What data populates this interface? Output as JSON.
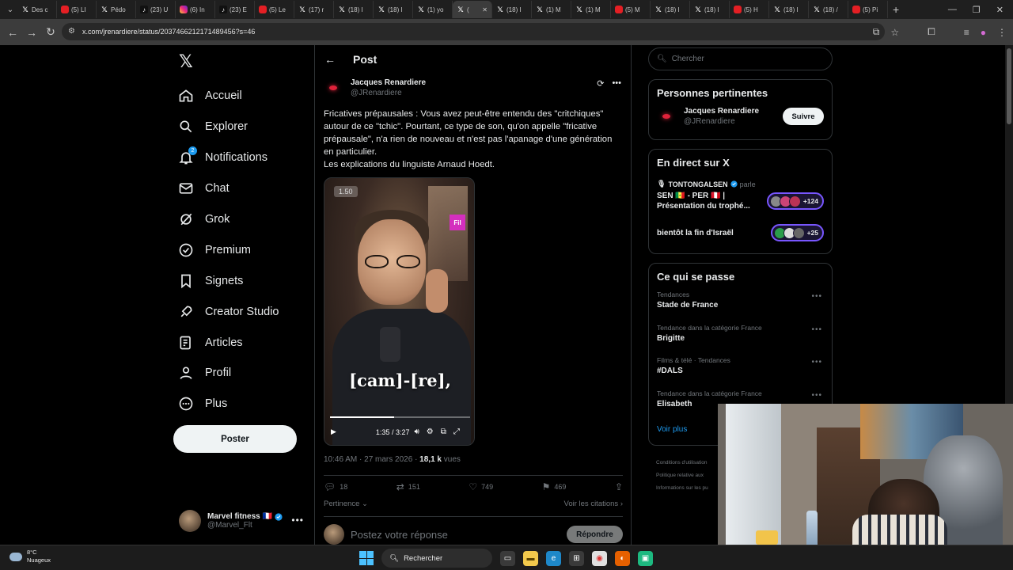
{
  "browser": {
    "tabs": [
      {
        "label": "Des c",
        "icon": "x"
      },
      {
        "label": "(5) LI",
        "icon": "yt"
      },
      {
        "label": "Pédo",
        "icon": "x"
      },
      {
        "label": "(23) U",
        "icon": "tk"
      },
      {
        "label": "(6) In",
        "icon": "ig"
      },
      {
        "label": "(23) E",
        "icon": "tk"
      },
      {
        "label": "(5) Le",
        "icon": "yt"
      },
      {
        "label": "(17) r",
        "icon": "x"
      },
      {
        "label": "(18) I",
        "icon": "x"
      },
      {
        "label": "(18) I",
        "icon": "x"
      },
      {
        "label": "(1) yo",
        "icon": "x"
      },
      {
        "label": "(",
        "icon": "x",
        "active": true
      },
      {
        "label": "(18) I",
        "icon": "x"
      },
      {
        "label": "(1) M",
        "icon": "x"
      },
      {
        "label": "(1) M",
        "icon": "x"
      },
      {
        "label": "(5) M",
        "icon": "yt"
      },
      {
        "label": "(18) I",
        "icon": "x"
      },
      {
        "label": "(18) I",
        "icon": "x"
      },
      {
        "label": "(5) H",
        "icon": "yt"
      },
      {
        "label": "(18) I",
        "icon": "x"
      },
      {
        "label": "(18) /",
        "icon": "x"
      },
      {
        "label": "(5) Pi",
        "icon": "yt"
      }
    ],
    "url": "x.com/jrenardiere/status/2037466212171489456?s=46"
  },
  "sidebar": {
    "items": [
      {
        "label": "Accueil",
        "icon": "home-icon"
      },
      {
        "label": "Explorer",
        "icon": "search-icon"
      },
      {
        "label": "Notifications",
        "icon": "bell-icon",
        "badge": "2"
      },
      {
        "label": "Chat",
        "icon": "mail-icon"
      },
      {
        "label": "Grok",
        "icon": "grok-icon"
      },
      {
        "label": "Premium",
        "icon": "verified-icon"
      },
      {
        "label": "Signets",
        "icon": "bookmark-icon"
      },
      {
        "label": "Creator Studio",
        "icon": "rocket-icon"
      },
      {
        "label": "Articles",
        "icon": "article-icon"
      },
      {
        "label": "Profil",
        "icon": "person-icon"
      },
      {
        "label": "Plus",
        "icon": "more-circle-icon"
      }
    ],
    "post_label": "Poster",
    "account": {
      "name": "Marvel fitness",
      "flag": "🇫🇷",
      "handle": "@Marvel_Flt"
    }
  },
  "post": {
    "header": "Post",
    "author_name": "Jacques Renardiere",
    "author_handle": "@JRenardiere",
    "text_1": "Fricatives prépausales : Vous avez peut-être entendu des \"critchiques\" autour de ce \"tchic\". Pourtant, ce type de son, qu'on appelle \"fricative prépausale\", n'a rien de nouveau et n'est pas l'apanage d'une génération en particulier.",
    "text_2": "Les explications du linguiste Arnaud Hoedt.",
    "video": {
      "badge": "1.50",
      "logo": "Fil",
      "caption": "[cam]-[re],",
      "time": "1:35 / 3:27",
      "progress": 0.46
    },
    "date": "10:46 AM · 27 mars 2026 · ",
    "views_count": "18,1 k",
    "views_label": " vues",
    "stats": {
      "replies": "18",
      "reposts": "151",
      "likes": "749",
      "bookmarks": "469"
    },
    "relevance": "Pertinence",
    "quotes": "Voir les citations",
    "reply_placeholder": "Postez votre réponse",
    "reply_button": "Répondre"
  },
  "right": {
    "search_placeholder": "Chercher",
    "relevant": {
      "title": "Personnes pertinentes",
      "name": "Jacques Renardiere",
      "handle": "@JRenardiere",
      "follow": "Suivre"
    },
    "live": {
      "title": "En direct sur X",
      "host": "TONTONGALSEN",
      "host_suffix": "parle",
      "spaces": [
        {
          "title": "SEN 🇸🇳 - PER 🇵🇪 | Présentation du trophé...",
          "count": "+124"
        },
        {
          "title": "bientôt la fin d'Israël",
          "count": "+25"
        }
      ]
    },
    "trends": {
      "title": "Ce qui se passe",
      "items": [
        {
          "category": "Tendances",
          "name": "Stade de France"
        },
        {
          "category": "Tendance dans la catégorie France",
          "name": "Brigitte"
        },
        {
          "category": "Films & télé · Tendances",
          "name": "#DALS"
        },
        {
          "category": "Tendance dans la catégorie France",
          "name": "Elisabeth"
        }
      ],
      "more": "Voir plus"
    },
    "footer": [
      "Conditions d'utilisation",
      "Politique relative aux",
      "Informations sur les pu"
    ]
  },
  "taskbar": {
    "temp": "8°C",
    "weather": "Nuageux",
    "search": "Rechercher"
  },
  "colors": {
    "accent": "#1d9bf0",
    "bg": "#000000",
    "border": "#2f3336",
    "muted": "#71767b"
  }
}
